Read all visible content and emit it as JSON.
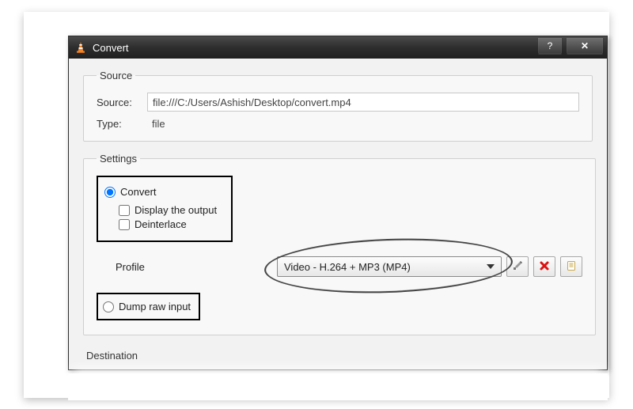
{
  "titlebar": {
    "title": "Convert",
    "help_label": "?",
    "close_label": "✕"
  },
  "source_group": {
    "legend": "Source",
    "source_label": "Source:",
    "source_value": "file:///C:/Users/Ashish/Desktop/convert.mp4",
    "type_label": "Type:",
    "type_value": "file"
  },
  "settings_group": {
    "legend": "Settings",
    "convert_label": "Convert",
    "display_label": "Display the output",
    "deinterlace_label": "Deinterlace",
    "profile_label": "Profile",
    "profile_value": "Video - H.264 + MP3 (MP4)",
    "dump_label": "Dump raw input"
  },
  "destination_group": {
    "legend": "Destination"
  },
  "icons": {
    "app": "vlc-cone-icon",
    "help": "help-icon",
    "close": "close-icon",
    "edit": "edit-profile-icon",
    "delete": "delete-profile-icon",
    "new": "new-profile-icon",
    "caret": "chevron-down-icon"
  }
}
